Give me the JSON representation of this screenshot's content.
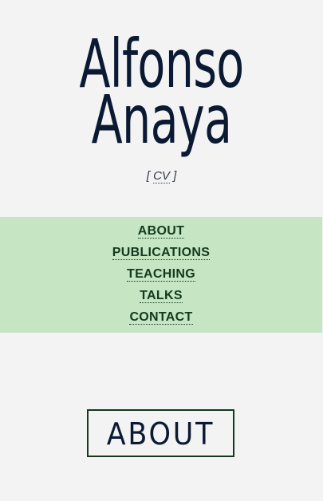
{
  "header": {
    "first_name": "Alfonso",
    "last_name": "Anaya",
    "cv_prefix": "[ ",
    "cv_label": "CV",
    "cv_suffix": " ]"
  },
  "nav": {
    "background": "#c5e5c3",
    "items": [
      {
        "label": "ABOUT"
      },
      {
        "label": "PUBLICATIONS"
      },
      {
        "label": "TEACHING"
      },
      {
        "label": "TALKS"
      },
      {
        "label": "CONTACT"
      }
    ]
  },
  "section": {
    "title": "ABOUT"
  }
}
